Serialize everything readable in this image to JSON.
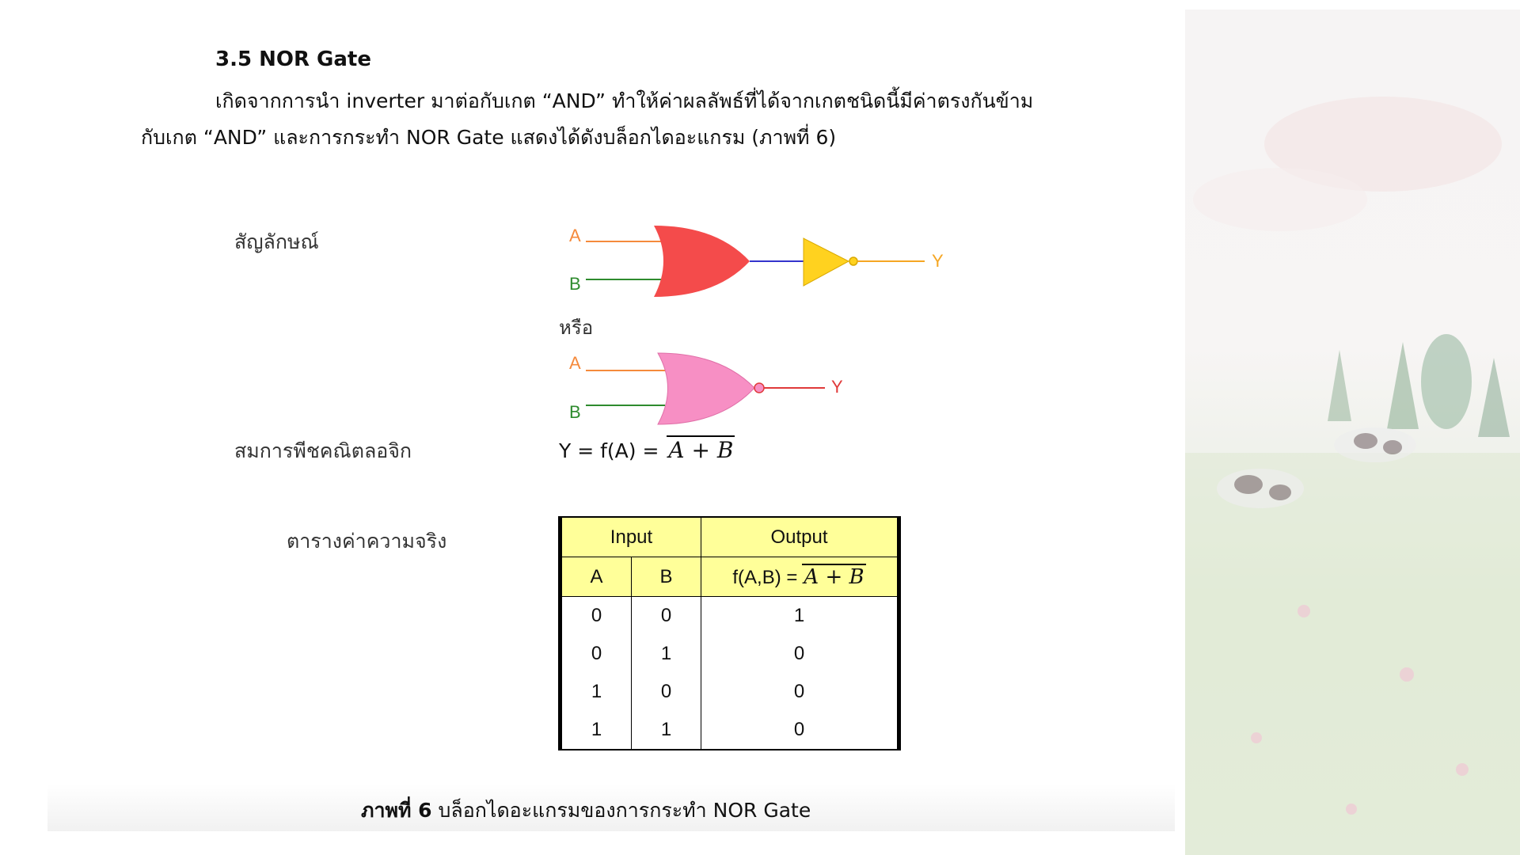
{
  "heading": "3.5 NOR Gate",
  "paragraph": {
    "line1": "เกิดจากการนำ inverter มาต่อกับเกต “AND” ทำให้ค่าผลลัพธ์ที่ได้จากเกตชนิดนี้มีค่าตรงกันข้าม",
    "line2": "กับเกต “AND” และการกระทำ NOR Gate แสดงได้ดังบล็อกไดอะแกรม (ภาพที่ 6)"
  },
  "symbol_label": "สัญลักษณ์",
  "or_label": "หรือ",
  "gate1": {
    "input_a": "A",
    "input_b": "B",
    "output": "Y",
    "colors": {
      "or_body": "#f44b4b",
      "inverter": "#ffd21f",
      "a_wire": "#f58a3c",
      "b_wire": "#2e8b2e",
      "mid_wire": "#3333cc",
      "out_wire": "#f5a623"
    }
  },
  "gate2": {
    "input_a": "A",
    "input_b": "B",
    "output": "Y",
    "colors": {
      "nor_body": "#f78fc4",
      "a_wire": "#f58a3c",
      "b_wire": "#2e8b2e",
      "out_wire": "#e03a3a"
    }
  },
  "equation_label": "สมการพีชคณิตลอจิก",
  "equation": {
    "lhs": "Y = f(A) =",
    "rhs": "A + B"
  },
  "truth_label": "ตารางค่าความจริง",
  "truth_table": {
    "header_input": "Input",
    "header_output": "Output",
    "col_a": "A",
    "col_b": "B",
    "col_f": "f(A,B) =",
    "col_f_expr": "A + B",
    "rows": [
      {
        "a": "0",
        "b": "0",
        "f": "1"
      },
      {
        "a": "0",
        "b": "1",
        "f": "0"
      },
      {
        "a": "1",
        "b": "0",
        "f": "0"
      },
      {
        "a": "1",
        "b": "1",
        "f": "0"
      }
    ]
  },
  "caption": {
    "prefix": "ภาพที่ 6",
    "text": " บล็อกไดอะแกรมของการกระทำ NOR Gate"
  }
}
